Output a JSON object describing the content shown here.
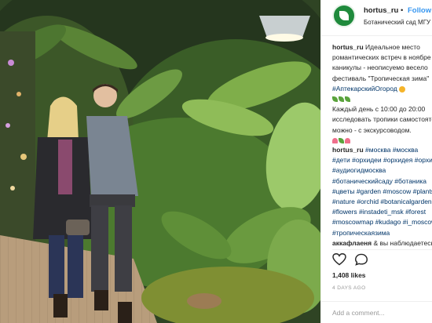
{
  "post": {
    "username": "hortus_ru",
    "separator": "•",
    "follow_label": "Follow",
    "location": "Ботанический сад МГУ",
    "caption_lines": [
      "Идеальное место",
      "романтических встреч в ноябре",
      "каникулы - неописуемо весело",
      "фестиваль \"Тропическая зима\"",
      "#АптекарскийОгород"
    ],
    "caption_lines_2": [
      "Каждый день с 10:00 до 20:00",
      "исследовать тропики самостоятельно",
      "можно - с экскурсоводом."
    ],
    "hashtag_lines": [
      "#москва #москва",
      "#дети #орхидеи #орхидея #орхидеи",
      "#аудиогидмосква",
      "#ботаническийсаду #ботаника",
      "#цветы #garden #moscow #plants",
      "#nature #orchid #botanicalgarden",
      "#flowers #instadeti_msk #forest",
      "#moscowmap #kudago #i_moscow",
      "#тропическаязима"
    ],
    "comment_user": "аккафлаеня",
    "comment_text": "& вы наблюдаетесь",
    "likes": "1,408 likes",
    "time_ago": "4 DAYS AGO",
    "add_comment_placeholder": "Add a comment..."
  },
  "icons": {
    "avatar": "leaf-logo-icon",
    "like": "heart-icon",
    "comment": "comment-bubble-icon"
  },
  "colors": {
    "accent": "#3897f0",
    "hashtag": "#003569",
    "avatar_bg": "#1f8a3c"
  }
}
